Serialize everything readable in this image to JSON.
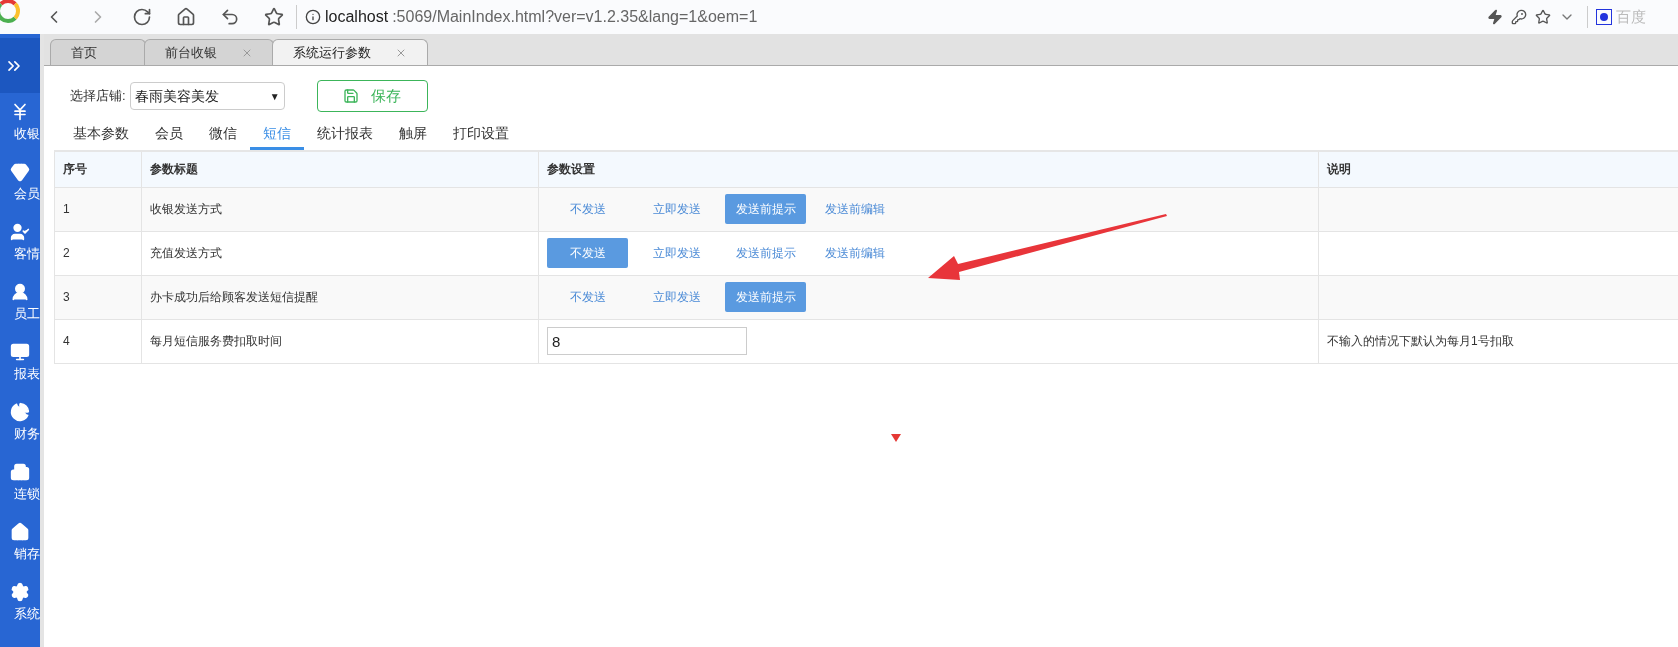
{
  "browser": {
    "url_host": "localhost",
    "url_rest": ":5069/MainIndex.html?ver=v1.2.35&lang=1&oem=1",
    "search_engine": "百度"
  },
  "sidebar": {
    "items": [
      {
        "label": "收银"
      },
      {
        "label": "会员"
      },
      {
        "label": "客情"
      },
      {
        "label": "员工"
      },
      {
        "label": "报表"
      },
      {
        "label": "财务"
      },
      {
        "label": "连锁"
      },
      {
        "label": "销存"
      },
      {
        "label": "系统"
      }
    ]
  },
  "page_tabs": [
    {
      "label": "首页",
      "selected": false,
      "closable": false
    },
    {
      "label": "前台收银",
      "selected": false,
      "closable": true
    },
    {
      "label": "系统运行参数",
      "selected": true,
      "closable": true
    }
  ],
  "store_select": {
    "label": "选择店铺:",
    "value": "春雨美容美发",
    "caret": "▼"
  },
  "save_button": "保存",
  "settings_tabs": [
    {
      "label": "基本参数",
      "selected": false
    },
    {
      "label": "会员",
      "selected": false
    },
    {
      "label": "微信",
      "selected": false
    },
    {
      "label": "短信",
      "selected": true
    },
    {
      "label": "统计报表",
      "selected": false
    },
    {
      "label": "触屏",
      "selected": false
    },
    {
      "label": "打印设置",
      "selected": false
    }
  ],
  "table": {
    "columns": [
      "序号",
      "参数标题",
      "参数设置",
      "说明"
    ],
    "rows": [
      {
        "no": "1",
        "title": "收银发送方式",
        "kind": "options",
        "options": [
          {
            "label": "不发送",
            "selected": false
          },
          {
            "label": "立即发送",
            "selected": false
          },
          {
            "label": "发送前提示",
            "selected": true
          },
          {
            "label": "发送前编辑",
            "selected": false
          }
        ]
      },
      {
        "no": "2",
        "title": "充值发送方式",
        "kind": "options",
        "options": [
          {
            "label": "不发送",
            "selected": true
          },
          {
            "label": "立即发送",
            "selected": false
          },
          {
            "label": "发送前提示",
            "selected": false
          },
          {
            "label": "发送前编辑",
            "selected": false
          }
        ]
      },
      {
        "no": "3",
        "title": "办卡成功后给顾客发送短信提醒",
        "kind": "options",
        "options": [
          {
            "label": "不发送",
            "selected": false
          },
          {
            "label": "立即发送",
            "selected": false
          },
          {
            "label": "发送前提示",
            "selected": true
          }
        ]
      },
      {
        "no": "4",
        "title": "每月短信服务费扣取时间",
        "kind": "input",
        "value": "8",
        "note": "不输入的情况下默认为每月1号扣取"
      }
    ]
  }
}
